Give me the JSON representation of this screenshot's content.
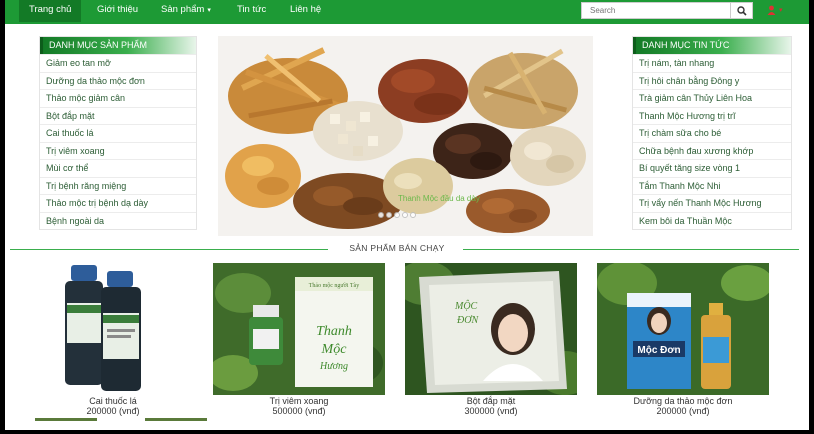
{
  "nav": {
    "items": [
      {
        "label": "Trang chủ",
        "active": true
      },
      {
        "label": "Giới thiệu"
      },
      {
        "label": "Sản phẩm",
        "dropdown": true
      },
      {
        "label": "Tin tức"
      },
      {
        "label": "Liên hệ"
      }
    ],
    "caret": "▾",
    "search_placeholder": "Search",
    "user_caret": "▾",
    "colors": {
      "bar": "#1d9a35",
      "active": "#137a26"
    }
  },
  "left_panel": {
    "title": "DANH MỤC SẢN PHẨM",
    "items": [
      "Giảm eo tan mỡ",
      "Dưỡng da thảo mộc đơn",
      "Thảo mộc giảm cân",
      "Bột đắp mặt",
      "Cai thuốc lá",
      "Trị viêm xoang",
      "Mùi cơ thể",
      "Trị bệnh răng miệng",
      "Thảo mộc trị bệnh dạ dày",
      "Bệnh ngoài da"
    ]
  },
  "right_panel": {
    "title": "DANH MỤC TIN TỨC",
    "items": [
      "Trị nám, tàn nhang",
      "Trị hôi chân bằng Đông y",
      "Trà giảm cân Thủy Liên Hoa",
      "Thanh Mộc Hương trị trĩ",
      "Trị chàm sữa cho bé",
      "Chữa bệnh đau xương khớp",
      "Bí quyết tăng size vòng 1",
      "Tắm Thanh Mộc Nhi",
      "Trị vẩy nến Thanh Mộc Hương",
      "Kem bôi da Thuần Mộc"
    ]
  },
  "slider": {
    "caption": "Thanh Mộc đầu da dày",
    "dots": 5,
    "active_dot": 0
  },
  "best_sellers": {
    "title": "SẢN PHẨM BÁN CHẠY",
    "products": [
      {
        "name": "Cai thuốc lá",
        "price": "200000 (vnđ)",
        "icon": "medicine-bottles-image"
      },
      {
        "name": "Trị viêm xoang",
        "price": "500000 (vnđ)",
        "icon": "nasal-spray-box-image",
        "box_text": "Thanh Mộc Hương"
      },
      {
        "name": "Bột đắp mặt",
        "price": "300000 (vnđ)",
        "icon": "face-mask-powder-bag-image",
        "box_text": "MỘC ĐƠN"
      },
      {
        "name": "Dưỡng da thảo mộc đơn",
        "price": "200000 (vnđ)",
        "icon": "herbal-skincare-box-image",
        "box_text": "Mộc Đơn"
      }
    ]
  }
}
